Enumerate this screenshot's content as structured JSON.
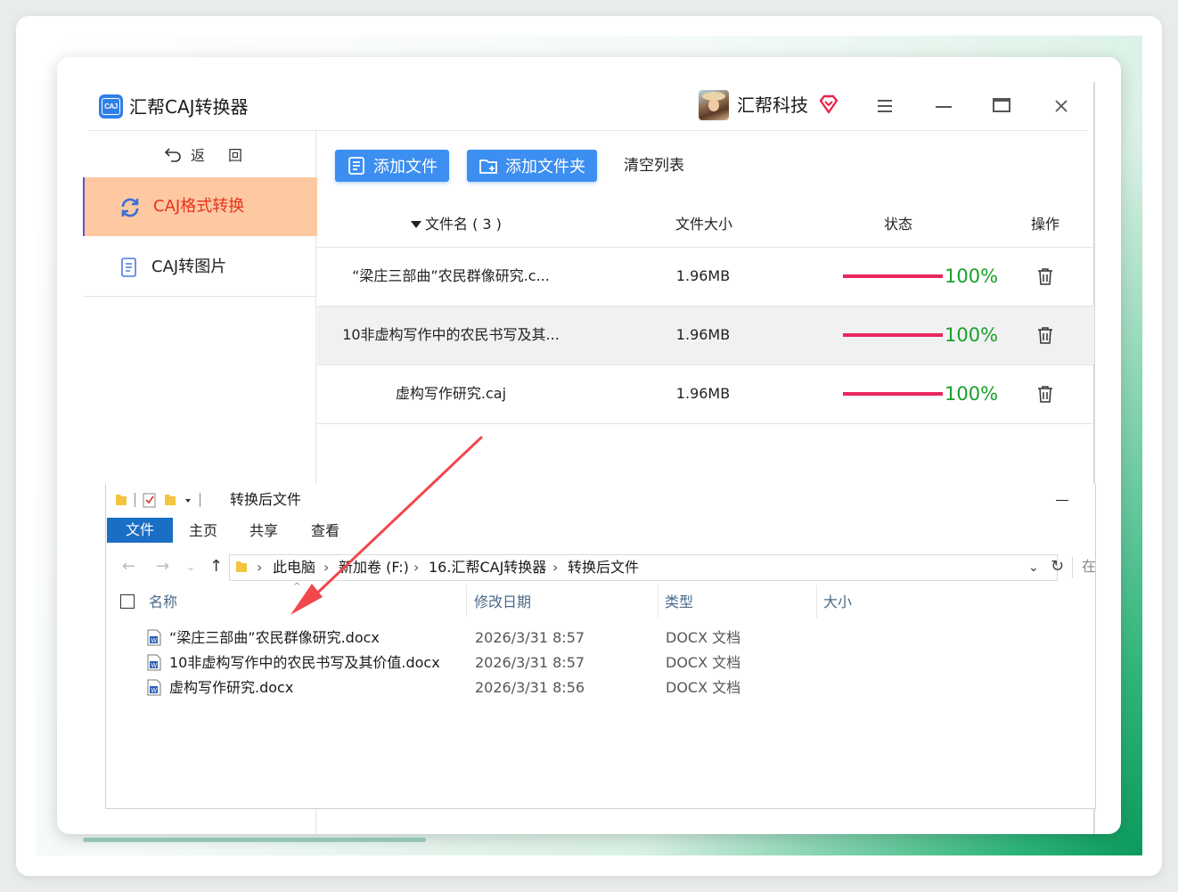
{
  "app": {
    "title": "汇帮CAJ转换器",
    "logo_text": "CAJ",
    "user_name": "汇帮科技"
  },
  "sidebar": {
    "back_label_1": "返",
    "back_label_2": "回",
    "items": [
      {
        "label": "CAJ格式转换",
        "active": true
      },
      {
        "label": "CAJ转图片",
        "active": false
      }
    ]
  },
  "toolbar": {
    "add_file": "添加文件",
    "add_folder": "添加文件夹",
    "clear_list": "清空列表"
  },
  "table": {
    "headers": {
      "name": "文件名 ( 3 )",
      "size": "文件大小",
      "status": "状态",
      "op": "操作"
    },
    "rows": [
      {
        "name": "“梁庄三部曲”农民群像研究.c...",
        "size": "1.96MB",
        "progress": 100,
        "percent": "100%"
      },
      {
        "name": "10非虚构写作中的农民书写及其...",
        "size": "1.96MB",
        "progress": 100,
        "percent": "100%"
      },
      {
        "name": "虚构写作研究.caj",
        "size": "1.96MB",
        "progress": 100,
        "percent": "100%"
      }
    ]
  },
  "explorer": {
    "title": "转换后文件",
    "tabs": {
      "file": "文件",
      "home": "主页",
      "share": "共享",
      "view": "查看"
    },
    "path": [
      "此电脑",
      "新加卷 (F:)",
      "16.汇帮CAJ转换器",
      "转换后文件"
    ],
    "search_hint": "在",
    "headers": {
      "name": "名称",
      "date": "修改日期",
      "type": "类型",
      "size": "大小"
    },
    "files": [
      {
        "name": "“梁庄三部曲”农民群像研究.docx",
        "date": "2026/3/31 8:57",
        "type": "DOCX 文档"
      },
      {
        "name": "10非虚构写作中的农民书写及其价值.docx",
        "date": "2026/3/31 8:57",
        "type": "DOCX 文档"
      },
      {
        "name": "虚构写作研究.docx",
        "date": "2026/3/31 8:56",
        "type": "DOCX 文档"
      }
    ]
  },
  "colors": {
    "accent_blue": "#3c8ef0",
    "active_bg": "#fec9a2",
    "active_text": "#e8321c",
    "progress": "#e8255f",
    "percent": "#17a12b",
    "annotation_arrow": "#f0484c"
  }
}
